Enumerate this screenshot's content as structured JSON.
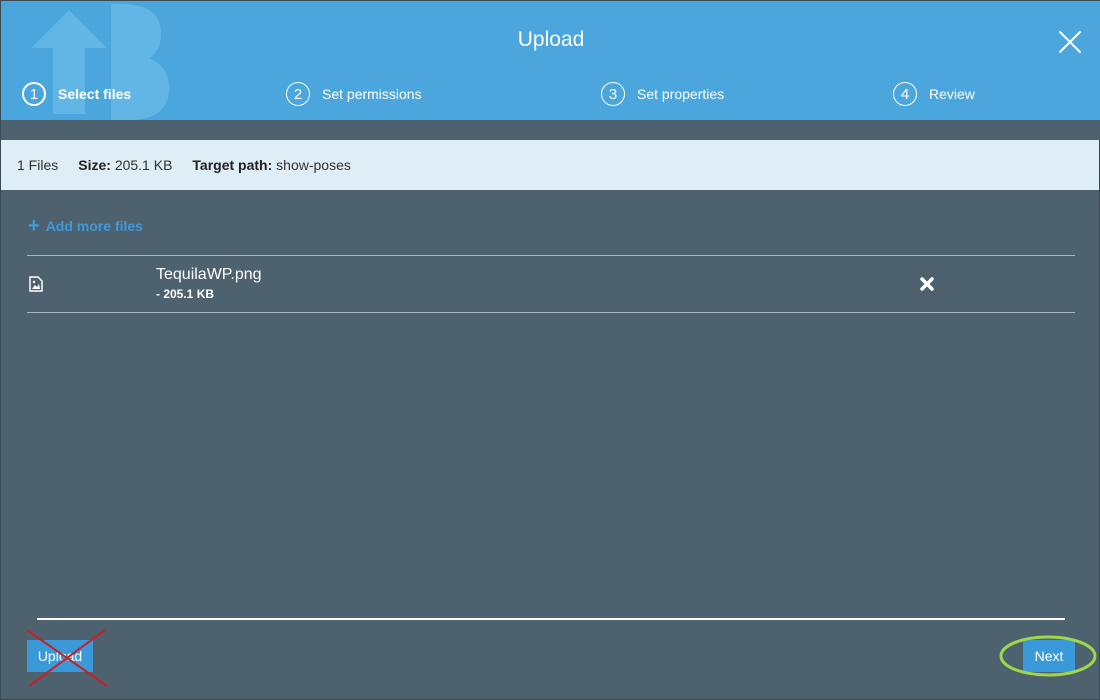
{
  "dialog": {
    "title": "Upload",
    "close_icon": "close-icon"
  },
  "steps": [
    {
      "number": "1",
      "label": "Select files",
      "active": true
    },
    {
      "number": "2",
      "label": "Set permissions",
      "active": false
    },
    {
      "number": "3",
      "label": "Set properties",
      "active": false
    },
    {
      "number": "4",
      "label": "Review",
      "active": false
    }
  ],
  "info": {
    "files_count": "1 Files",
    "size_label": "Size:",
    "size_value": "205.1 KB",
    "target_label": "Target path:",
    "target_value": "show-poses"
  },
  "add_more": {
    "icon": "plus-icon",
    "label": "Add more files"
  },
  "files": [
    {
      "name": "TequilaWP.png",
      "size": "- 205.1 KB",
      "icon": "image-file-icon"
    }
  ],
  "footer": {
    "upload_label": "Upload",
    "next_label": "Next"
  },
  "colors": {
    "header": "#4aa6dd",
    "body": "#4d616f",
    "info_bar": "#deedf6",
    "accent": "#3a9ad9",
    "annotation_strike": "#cc1f1f",
    "annotation_highlight": "#9ed84a"
  }
}
